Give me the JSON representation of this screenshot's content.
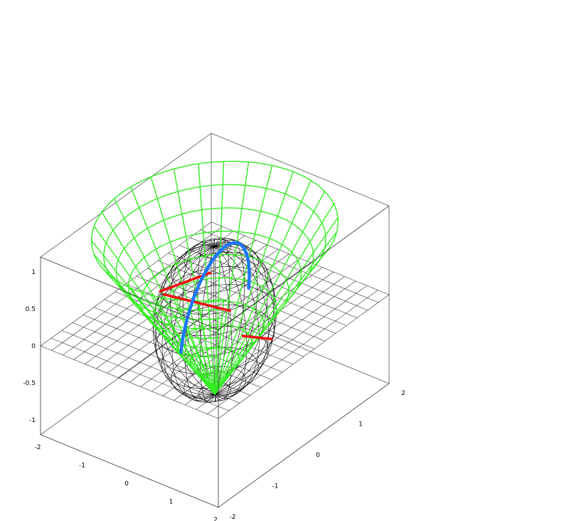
{
  "chart_data": {
    "type": "surface3d",
    "title": "",
    "box": {
      "x_range": [
        -2,
        2
      ],
      "y_range": [
        -2,
        2
      ],
      "z_range": [
        -1.2,
        1.2
      ],
      "frame": "wireframe box"
    },
    "axes": {
      "x": {
        "ticks": [
          -2,
          -1,
          0,
          1,
          2
        ],
        "tick_labels": [
          "-2",
          "-1",
          "0",
          "1",
          "2"
        ]
      },
      "y": {
        "ticks": [
          -2,
          -1,
          0,
          1,
          2
        ],
        "tick_labels": [
          "-2",
          "-1",
          "0",
          "1",
          "2"
        ]
      },
      "z": {
        "ticks": [
          -1,
          -0.5,
          0,
          0.5,
          1
        ],
        "tick_labels": [
          "-1",
          "-0.5",
          "0",
          "0.5",
          "1"
        ]
      }
    },
    "surfaces": [
      {
        "name": "",
        "kind": "plane z = 0",
        "color": "#000000",
        "mesh": "16x16"
      },
      {
        "name": "",
        "kind": "unit sphere",
        "color": "#000000",
        "mesh": "24 meridians x 12 parallels"
      },
      {
        "name": "",
        "kind": "cone (tangent surface)",
        "color": "#33ee22"
      }
    ],
    "curves": [
      {
        "name": "",
        "kind": "great circle on sphere",
        "color": "#1e78ff"
      },
      {
        "name": "",
        "kind": "curve on sphere",
        "color": "#ee1111"
      }
    ]
  }
}
